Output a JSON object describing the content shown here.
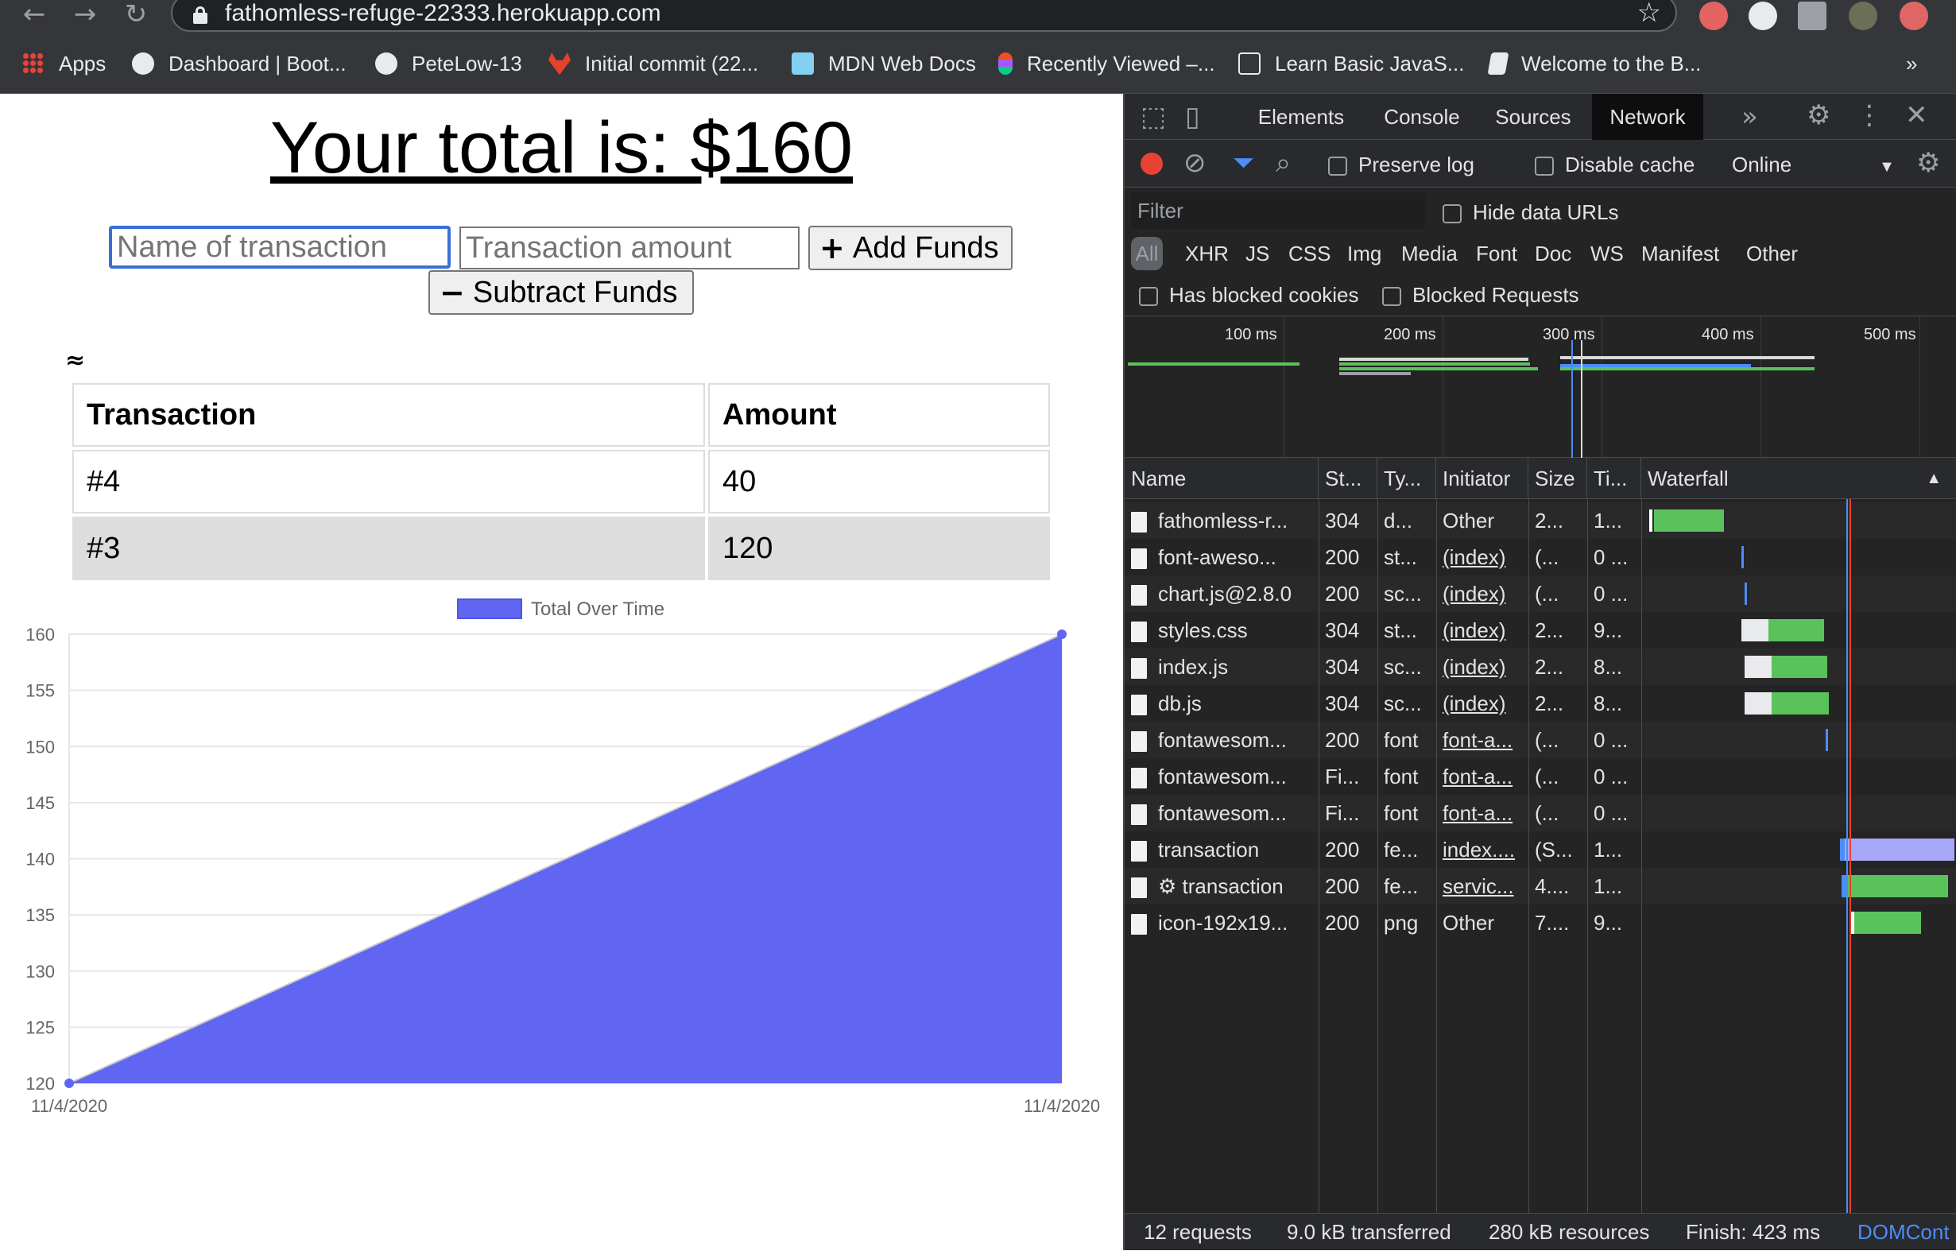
{
  "browser": {
    "url": "fathomless-refuge-22333.herokuapp.com",
    "nav": {
      "back": "←",
      "forward": "→",
      "reload": "↻"
    },
    "star": "☆",
    "bookmarks": [
      {
        "label": "Apps",
        "icon": "apps-grid-icon",
        "color": "#ea4335"
      },
      {
        "label": "Dashboard | Boot...",
        "icon": "globe-icon",
        "color": "#e8eaed"
      },
      {
        "label": "PeteLow-13",
        "icon": "github-icon",
        "color": "#e8eaed"
      },
      {
        "label": "Initial commit (22...",
        "icon": "gitlab-icon",
        "color": "#e24329"
      },
      {
        "label": "MDN Web Docs",
        "icon": "mdn-icon",
        "color": "#83d0f2"
      },
      {
        "label": "Recently Viewed –...",
        "icon": "figma-icon",
        "color": "#f24e1e"
      },
      {
        "label": "Learn Basic JavaS...",
        "icon": "freecodecamp-icon",
        "color": "#e8eaed"
      },
      {
        "label": "Welcome to the B...",
        "icon": "book-icon",
        "color": "#e8eaed"
      }
    ],
    "overflow": "»"
  },
  "page": {
    "total_text": "Your total is: $160",
    "name_placeholder": "Name of transaction",
    "amount_placeholder": "Transaction amount",
    "add_label": "Add Funds",
    "add_icon": "+",
    "subtract_label": "Subtract Funds",
    "subtract_icon": "−",
    "approx": "≈",
    "table": {
      "headers": [
        "Transaction",
        "Amount"
      ],
      "rows": [
        [
          "#4",
          "40"
        ],
        [
          "#3",
          "120"
        ]
      ]
    }
  },
  "chart_data": {
    "type": "area",
    "x": [
      "11/4/2020",
      "11/4/2020"
    ],
    "series": [
      {
        "name": "Total Over Time",
        "values": [
          120,
          160
        ]
      }
    ],
    "ylim": [
      120,
      160
    ],
    "yticks": [
      120,
      125,
      130,
      135,
      140,
      145,
      150,
      155,
      160
    ],
    "legend": "top-center",
    "color": "#6166f2",
    "grid": true
  },
  "devtools": {
    "tabs": [
      "Elements",
      "Console",
      "Sources",
      "Network"
    ],
    "active_tab": "Network",
    "preserve_log": "Preserve log",
    "disable_cache": "Disable cache",
    "throttle": "Online",
    "filter_placeholder": "Filter",
    "hide_data_urls": "Hide data URLs",
    "types": [
      "All",
      "XHR",
      "JS",
      "CSS",
      "Img",
      "Media",
      "Font",
      "Doc",
      "WS",
      "Manifest",
      "Other"
    ],
    "has_blocked_cookies": "Has blocked cookies",
    "blocked_requests": "Blocked Requests",
    "timeline_labels": [
      "100 ms",
      "200 ms",
      "300 ms",
      "400 ms",
      "500 ms"
    ],
    "columns": [
      "Name",
      "St...",
      "Ty...",
      "Initiator",
      "Size",
      "Ti...",
      "Waterfall"
    ],
    "rows": [
      {
        "name": "fathomless-r...",
        "status": "304",
        "type": "d...",
        "initiator": "Other",
        "init_link": false,
        "size": "2...",
        "time": "1..."
      },
      {
        "name": "font-aweso...",
        "status": "200",
        "type": "st...",
        "initiator": "(index)",
        "init_link": true,
        "size": "(...",
        "time": "0 ..."
      },
      {
        "name": "chart.js@2.8.0",
        "status": "200",
        "type": "sc...",
        "initiator": "(index)",
        "init_link": true,
        "size": "(...",
        "time": "0 ..."
      },
      {
        "name": "styles.css",
        "status": "304",
        "type": "st...",
        "initiator": "(index)",
        "init_link": true,
        "size": "2...",
        "time": "9..."
      },
      {
        "name": "index.js",
        "status": "304",
        "type": "sc...",
        "initiator": "(index)",
        "init_link": true,
        "size": "2...",
        "time": "8..."
      },
      {
        "name": "db.js",
        "status": "304",
        "type": "sc...",
        "initiator": "(index)",
        "init_link": true,
        "size": "2...",
        "time": "8..."
      },
      {
        "name": "fontawesom...",
        "status": "200",
        "type": "font",
        "initiator": "font-a...",
        "init_link": true,
        "size": "(...",
        "time": "0 ..."
      },
      {
        "name": "fontawesom...",
        "status": "Fi...",
        "type": "font",
        "initiator": "font-a...",
        "init_link": true,
        "size": "(...",
        "time": "0 ..."
      },
      {
        "name": "fontawesom...",
        "status": "Fi...",
        "type": "font",
        "initiator": "font-a...",
        "init_link": true,
        "size": "(...",
        "time": "0 ..."
      },
      {
        "name": "transaction",
        "status": "200",
        "type": "fe...",
        "initiator": "index....",
        "init_link": true,
        "size": "(S...",
        "time": "1..."
      },
      {
        "name": "⚙ transaction",
        "status": "200",
        "type": "fe...",
        "initiator": "servic...",
        "init_link": true,
        "size": "4....",
        "time": "1..."
      },
      {
        "name": "icon-192x19...",
        "status": "200",
        "type": "png",
        "initiator": "Other",
        "init_link": false,
        "size": "7....",
        "time": "9..."
      }
    ],
    "status": {
      "requests": "12 requests",
      "transferred": "9.0 kB transferred",
      "resources": "280 kB resources",
      "finish": "Finish: 423 ms",
      "domcontent": "DOMCont"
    }
  }
}
